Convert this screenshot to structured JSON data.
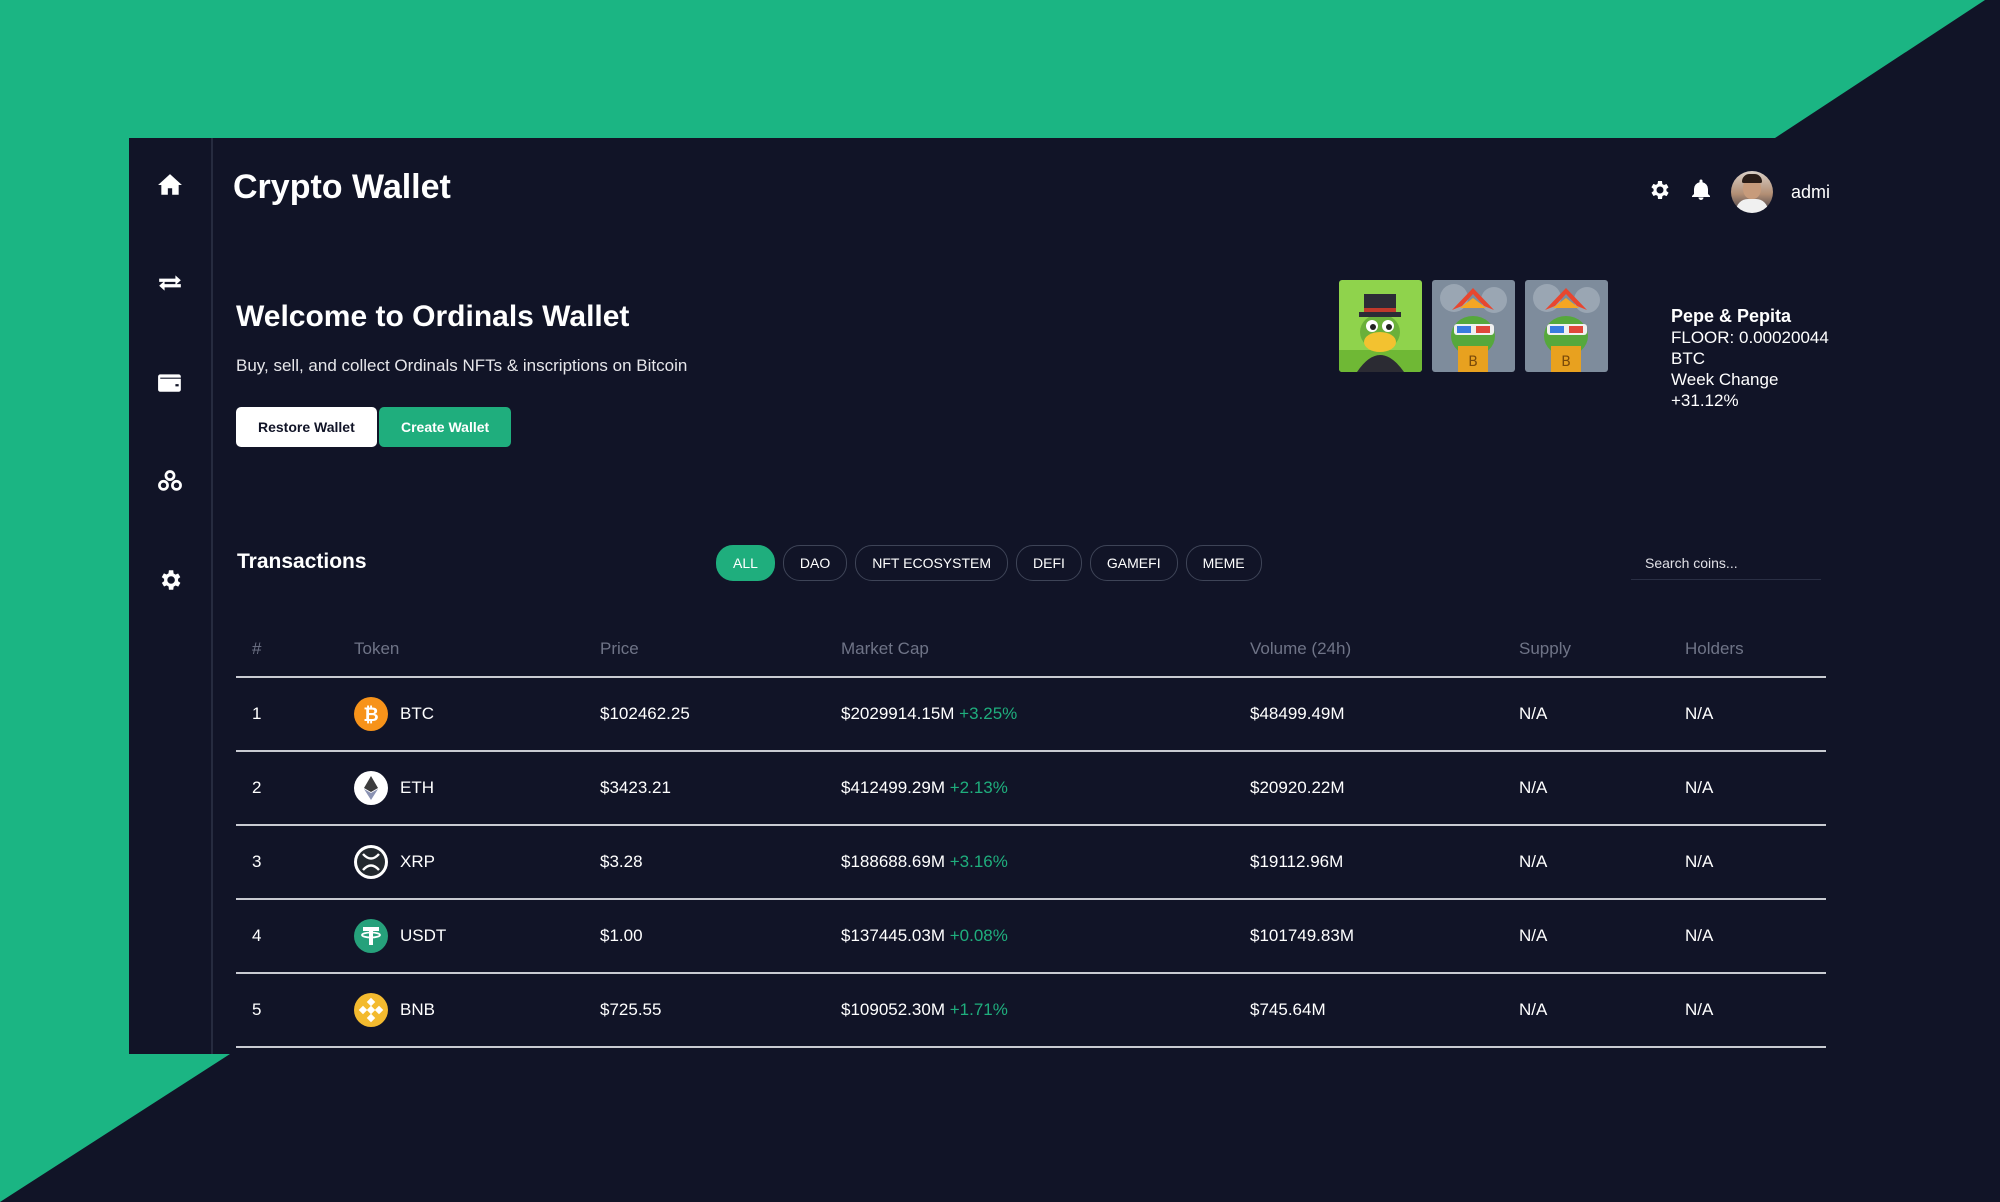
{
  "app": {
    "title": "Crypto Wallet"
  },
  "sidebar": {
    "items": [
      {
        "name": "home",
        "icon": "home-icon"
      },
      {
        "name": "transfer",
        "icon": "swap-icon"
      },
      {
        "name": "wallet",
        "icon": "wallet-icon"
      },
      {
        "name": "coins",
        "icon": "coins-icon"
      },
      {
        "name": "settings",
        "icon": "gear-icon"
      }
    ]
  },
  "topbar": {
    "user_name": "admi",
    "settings_icon": "gear-icon",
    "notifications_icon": "bell-icon"
  },
  "hero": {
    "title": "Welcome to Ordinals Wallet",
    "subtitle": "Buy, sell, and collect Ordinals NFTs & inscriptions on Bitcoin",
    "restore_label": "Restore Wallet",
    "create_label": "Create Wallet"
  },
  "collection": {
    "name": "Pepe & Pepita",
    "floor": "FLOOR: 0.00020044",
    "floor_unit": "BTC",
    "week_label": "Week Change",
    "week_value": "+31.12%"
  },
  "transactions": {
    "title": "Transactions",
    "filters": [
      "ALL",
      "DAO",
      "NFT ECOSYSTEM",
      "DEFI",
      "GAMEFI",
      "MEME"
    ],
    "active_filter": "ALL",
    "search_placeholder": "Search coins...",
    "columns": [
      "#",
      "Token",
      "Price",
      "Market Cap",
      "Volume (24h)",
      "Supply",
      "Holders"
    ],
    "rows": [
      {
        "rank": "1",
        "symbol": "BTC",
        "price": "$102462.25",
        "market_cap": "$2029914.15M",
        "change": "+3.25%",
        "volume": "$48499.49M",
        "supply": "N/A",
        "holders": "N/A",
        "icon": "bitcoin-icon"
      },
      {
        "rank": "2",
        "symbol": "ETH",
        "price": "$3423.21",
        "market_cap": "$412499.29M",
        "change": "+2.13%",
        "volume": "$20920.22M",
        "supply": "N/A",
        "holders": "N/A",
        "icon": "ethereum-icon"
      },
      {
        "rank": "3",
        "symbol": "XRP",
        "price": "$3.28",
        "market_cap": "$188688.69M",
        "change": "+3.16%",
        "volume": "$19112.96M",
        "supply": "N/A",
        "holders": "N/A",
        "icon": "xrp-icon"
      },
      {
        "rank": "4",
        "symbol": "USDT",
        "price": "$1.00",
        "market_cap": "$137445.03M",
        "change": "+0.08%",
        "volume": "$101749.83M",
        "supply": "N/A",
        "holders": "N/A",
        "icon": "tether-icon"
      },
      {
        "rank": "5",
        "symbol": "BNB",
        "price": "$725.55",
        "market_cap": "$109052.30M",
        "change": "+1.71%",
        "volume": "$745.64M",
        "supply": "N/A",
        "holders": "N/A",
        "icon": "bnb-icon"
      }
    ]
  },
  "colors": {
    "accent": "#1fae7d",
    "background": "#111427"
  }
}
